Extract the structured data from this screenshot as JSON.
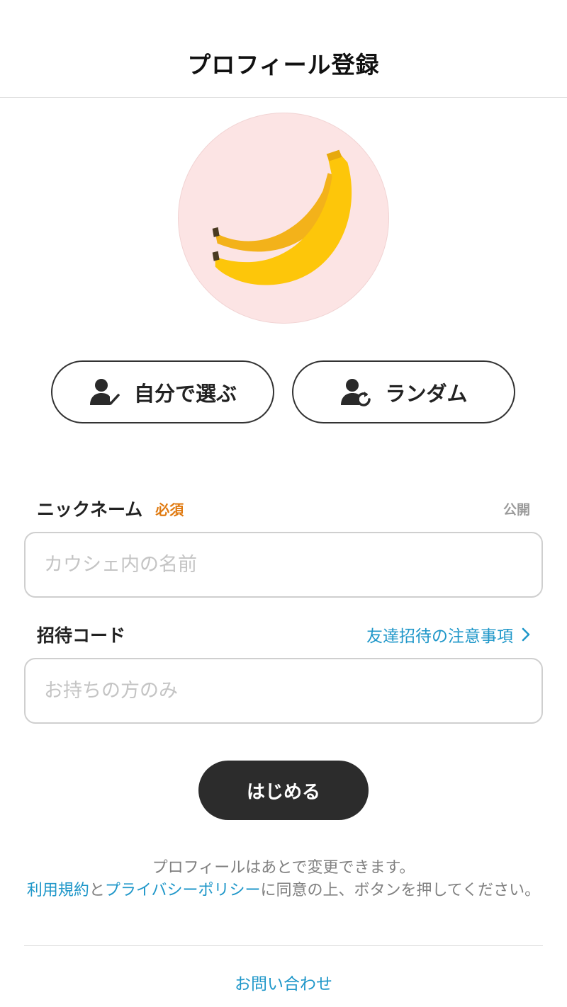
{
  "header": {
    "title": "プロフィール登録"
  },
  "avatar": {
    "icon": "banana-icon",
    "background": "#fce4e4"
  },
  "avatar_buttons": {
    "choose_label": "自分で選ぶ",
    "random_label": "ランダム"
  },
  "nickname": {
    "label": "ニックネーム",
    "required_badge": "必須",
    "visibility": "公開",
    "placeholder": "カウシェ内の名前",
    "value": ""
  },
  "invite_code": {
    "label": "招待コード",
    "note_link": "友達招待の注意事項",
    "placeholder": "お持ちの方のみ",
    "value": ""
  },
  "start_button": {
    "label": "はじめる"
  },
  "notice": {
    "line1": "プロフィールはあとで変更できます。",
    "terms_link": "利用規約",
    "and": "と",
    "privacy_link": "プライバシーポリシー",
    "suffix": "に同意の上、ボタンを押してください。"
  },
  "footer": {
    "contact_link": "お問い合わせ"
  },
  "colors": {
    "accent": "#1f97c9",
    "required": "#e07a10",
    "primary_button": "#2c2c2c"
  }
}
